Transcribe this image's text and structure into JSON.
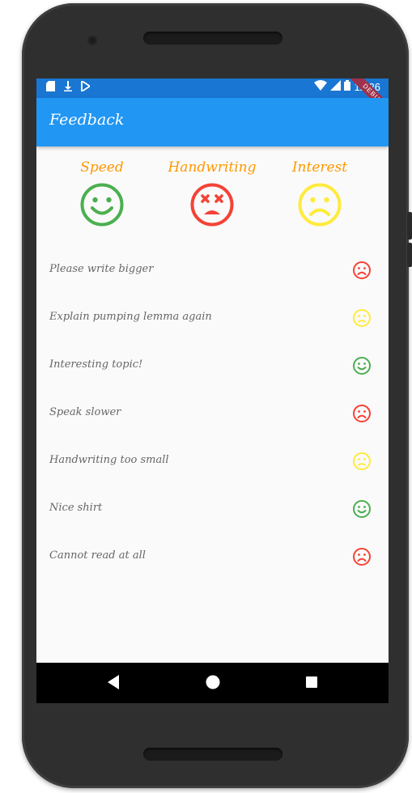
{
  "status_bar": {
    "time": "12:26",
    "debug_banner": "DEBUG"
  },
  "app_bar": {
    "title": "Feedback"
  },
  "ratings": [
    {
      "label": "Speed",
      "mood": "happy",
      "color": "#4caf50"
    },
    {
      "label": "Handwriting",
      "mood": "dizzy",
      "color": "#f44336"
    },
    {
      "label": "Interest",
      "mood": "sad",
      "color": "#ffeb3b"
    }
  ],
  "feedback_items": [
    {
      "text": "Please write bigger",
      "mood": "sad",
      "color": "#f44336"
    },
    {
      "text": "Explain pumping lemma again",
      "mood": "neutral",
      "color": "#ffeb3b"
    },
    {
      "text": "Interesting topic!",
      "mood": "happy",
      "color": "#4caf50"
    },
    {
      "text": "Speak slower",
      "mood": "sad",
      "color": "#f44336"
    },
    {
      "text": "Handwriting too small",
      "mood": "neutral",
      "color": "#ffeb3b"
    },
    {
      "text": "Nice shirt",
      "mood": "happy",
      "color": "#4caf50"
    },
    {
      "text": "Cannot read at all",
      "mood": "sad",
      "color": "#f44336"
    }
  ],
  "nav_bar": {
    "back_icon": "back-triangle-icon",
    "home_icon": "home-circle-icon",
    "recents_icon": "recents-square-icon"
  },
  "colors": {
    "status_bar": "#1976d2",
    "app_bar": "#2196f3",
    "rating_label": "#ff9800"
  }
}
